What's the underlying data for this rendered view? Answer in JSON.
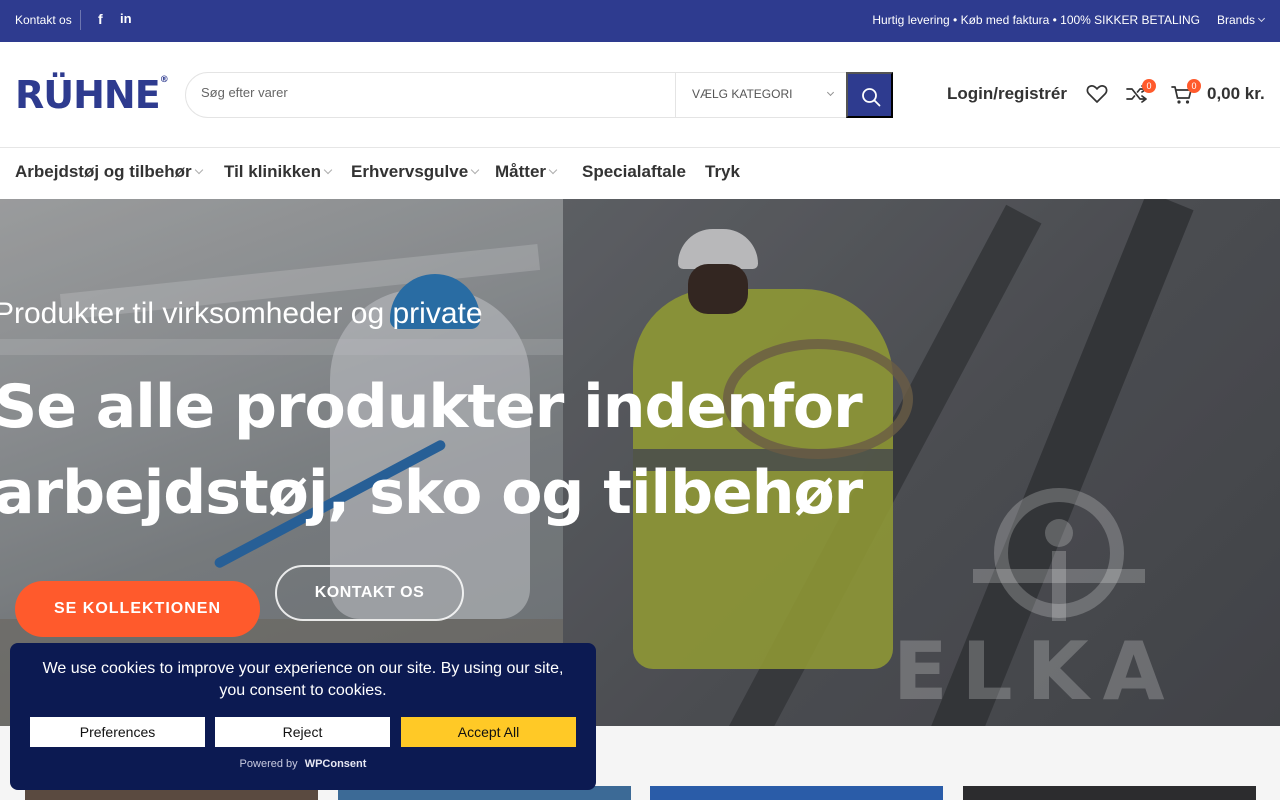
{
  "topbar": {
    "contact": "Kontakt os",
    "facebook_glyph": "f",
    "linkedin_glyph": "in",
    "promo": "Hurtig levering • Køb med faktura • 100% SIKKER BETALING",
    "brands": "Brands"
  },
  "header": {
    "logo_text": "RÜHNE",
    "logo_mark": "®",
    "search_placeholder": "Søg efter varer",
    "category_label": "VÆLG KATEGORI",
    "login": "Login/registrér",
    "compare_count": "0",
    "cart_count": "0",
    "cart_total": "0,00 kr."
  },
  "nav": {
    "items": [
      {
        "label": "Arbejdstøj og tilbehør"
      },
      {
        "label": "Til klinikken"
      },
      {
        "label": "Erhvervsgulve"
      },
      {
        "label": "Måtter"
      },
      {
        "label": "Specialaftale"
      },
      {
        "label": "Tryk"
      }
    ]
  },
  "hero": {
    "subtitle": "Produkter til virksomheder og private",
    "headline_line1": "Se alle produkter indenfor",
    "headline_line2": "arbejdstøj, sko og tilbehør",
    "cta_primary": "SE KOLLEKTIONEN",
    "cta_secondary": "KONTAKT OS",
    "watermark_text": "ELKA"
  },
  "cookie": {
    "message": "We use cookies to improve your experience on our site. By using our site, you consent to cookies.",
    "preferences": "Preferences",
    "reject": "Reject",
    "accept": "Accept All",
    "powered_by": "Powered by",
    "powered_brand": "WPConsent"
  },
  "colors": {
    "brand_blue": "#2e3b8f",
    "accent_orange": "#ff5a2c",
    "cookie_bg": "#0c1a52",
    "accept_yellow": "#ffc926"
  }
}
